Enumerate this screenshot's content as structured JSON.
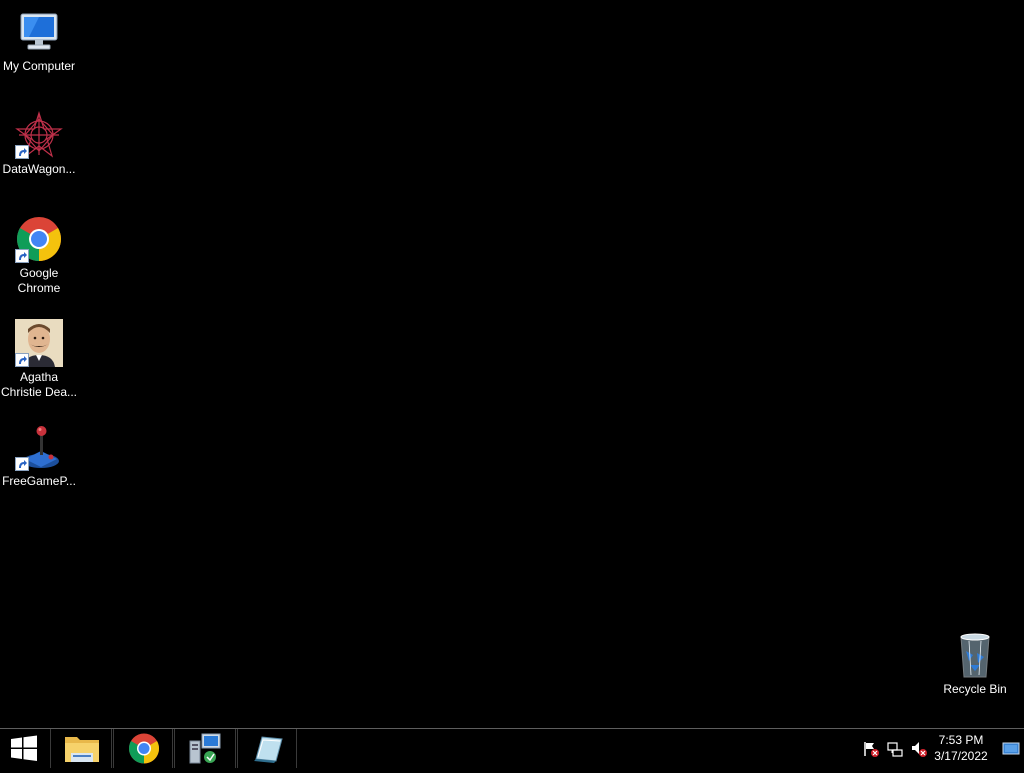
{
  "desktop": {
    "icons": [
      {
        "label": "My Computer",
        "icon": "computer-icon",
        "shortcut": false
      },
      {
        "label": "DataWagon...",
        "icon": "datawagon-icon",
        "shortcut": true
      },
      {
        "label": "Google\nChrome",
        "icon": "chrome-icon",
        "shortcut": true
      },
      {
        "label": "Agatha\nChristie Dea...",
        "icon": "agatha-christie-icon",
        "shortcut": true
      },
      {
        "label": "FreeGameP...",
        "icon": "joystick-icon",
        "shortcut": true
      }
    ],
    "recycle_bin": {
      "label": "Recycle Bin",
      "icon": "recycle-bin-icon"
    }
  },
  "taskbar": {
    "start_icon": "windows-logo-icon",
    "pinned": [
      {
        "name": "File Explorer",
        "icon": "folder-icon"
      },
      {
        "name": "Google Chrome",
        "icon": "chrome-icon"
      },
      {
        "name": "Network Setup",
        "icon": "network-app-icon"
      },
      {
        "name": "Notepad",
        "icon": "notepad-icon"
      }
    ],
    "tray": {
      "icons": [
        "action-center-flag-icon",
        "network-icon",
        "volume-muted-icon"
      ],
      "time": "7:53 PM",
      "date": "3/17/2022",
      "show_desktop_icon": "show-desktop-icon"
    }
  },
  "colors": {
    "background": "#000000",
    "text": "#ffffff",
    "taskbar_border": "#5e5e5e"
  }
}
